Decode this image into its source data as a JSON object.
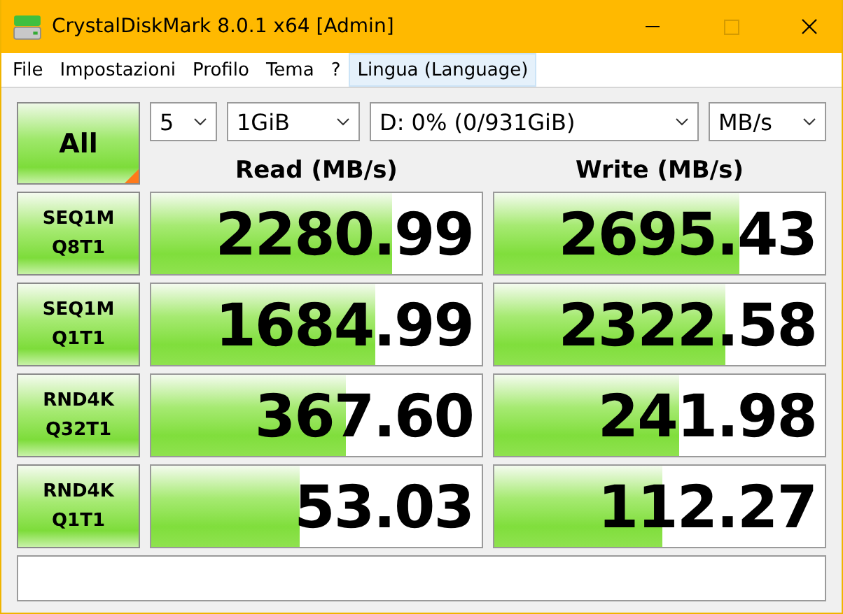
{
  "window": {
    "title": "CrystalDiskMark 8.0.1 x64 [Admin]"
  },
  "menu": [
    {
      "label": "File",
      "selected": false
    },
    {
      "label": "Impostazioni",
      "selected": false
    },
    {
      "label": "Profilo",
      "selected": false
    },
    {
      "label": "Tema",
      "selected": false
    },
    {
      "label": "?",
      "selected": false
    },
    {
      "label": "Lingua (Language)",
      "selected": true
    }
  ],
  "all_button": "All",
  "selectors": [
    {
      "value": "5"
    },
    {
      "value": "1GiB"
    },
    {
      "value": "D: 0% (0/931GiB)"
    },
    {
      "value": "MB/s"
    }
  ],
  "columns": [
    "Read (MB/s)",
    "Write (MB/s)"
  ],
  "rows": [
    {
      "test": "SEQ1M",
      "params": "Q8T1",
      "read": {
        "value": "2280.99",
        "level": 0.73
      },
      "write": {
        "value": "2695.43",
        "level": 0.74
      }
    },
    {
      "test": "SEQ1M",
      "params": "Q1T1",
      "read": {
        "value": "1684.99",
        "level": 0.68
      },
      "write": {
        "value": "2322.58",
        "level": 0.7
      }
    },
    {
      "test": "RND4K",
      "params": "Q32T1",
      "read": {
        "value": "367.60",
        "level": 0.59
      },
      "write": {
        "value": "241.98",
        "level": 0.56
      }
    },
    {
      "test": "RND4K",
      "params": "Q1T1",
      "read": {
        "value": "53.03",
        "level": 0.45
      },
      "write": {
        "value": "112.27",
        "level": 0.51
      }
    }
  ]
}
